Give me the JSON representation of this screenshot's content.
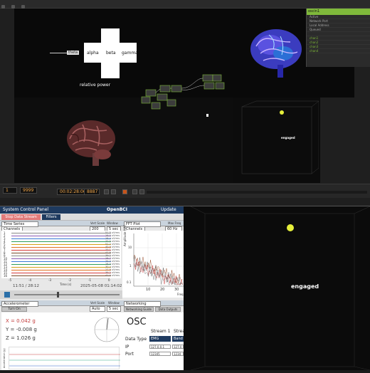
{
  "touchdesigner": {
    "bands": [
      "theta",
      "alpha",
      "beta",
      "gamma"
    ],
    "relative_power_label": "relative power",
    "engaged_label": "engaged",
    "panel_title": "oscin1",
    "panel_rows": [
      "Active",
      "Network Port",
      "Local Address",
      "Queued",
      "",
      "chan1",
      "chan2",
      "chan3",
      "chan4"
    ],
    "timeline": {
      "time": "00:02:28:06",
      "frame": "8887",
      "start": "1",
      "end": "9999"
    }
  },
  "openbci": {
    "logo": "OpenBCI",
    "system_control_panel": "System Control Panel",
    "update": "Update",
    "stop_stream": "Stop Data Stream",
    "filters": "Filters",
    "time_series": {
      "widget": "Time Series",
      "vert_scale_label": "Vert Scale",
      "window_label": "Window",
      "vert_scale": "200 uV",
      "window": "5 sec",
      "channels_label": "Channels",
      "channel_numbers": [
        "1",
        "2",
        "3",
        "4",
        "5",
        "6",
        "7",
        "8",
        "9",
        "10",
        "11",
        "12",
        "13",
        "14",
        "15",
        "16"
      ],
      "channel_uv": [
        "51.5 uVrms",
        "28.0 uVrms",
        "28.4 uVrms",
        "37.5 uVrms",
        "51.2 uVrms",
        "40.9 uVrms",
        "33.1 uVrms",
        "47.8 uVrms",
        "39.2 uVrms",
        "28.7 uVrms",
        "34.0 uVrms",
        "28.5 uVrms",
        "30.4 uVrms",
        "27.9 uVrms",
        "35.2 uVrms",
        "41.0 uVrms"
      ],
      "x_ticks": [
        "-5",
        "-4",
        "-3",
        "-2",
        "-1",
        "0"
      ],
      "x_label": "Time (s)",
      "elapsed": "11:51 / 28:12",
      "timestamp": "2025-05-08 01:14:02"
    },
    "fft": {
      "widget": "FFT Plot",
      "max_freq_label": "Max Freq",
      "max_freq": "60 Hz",
      "ylabel": "Amplitude (uV)",
      "xlabel": "Freq",
      "x_ticks": [
        "10",
        "20",
        "30"
      ],
      "y_ticks": [
        "10",
        "1",
        "0.1"
      ],
      "channels_label": "Channels"
    },
    "accel": {
      "widget": "Accelerometer",
      "vert_scale_label": "Vert Scale",
      "window_label": "Window",
      "vert_scale": "Auto",
      "window": "5 sec",
      "toggle": "Turn On",
      "x": "X = 0.042 g",
      "y": "Y = -0.008 g",
      "z": "Z = 1.026 g",
      "ylabel": "Acceleration (g)"
    },
    "networking": {
      "widget": "Networking",
      "guide": "Networking Guide",
      "outputs": "Data Outputs",
      "protocol": "OSC",
      "stream1": "Stream 1",
      "stream2": "Strea",
      "data_type_label": "Data Type",
      "data_type": "EMG",
      "data_type2": "Band",
      "ip_label": "IP",
      "ip": "127.0.0.1",
      "ip2": "127.0",
      "port_label": "Port",
      "port": "12345",
      "port2": "1234"
    }
  },
  "right_view": {
    "engaged_label": "engaged"
  }
}
